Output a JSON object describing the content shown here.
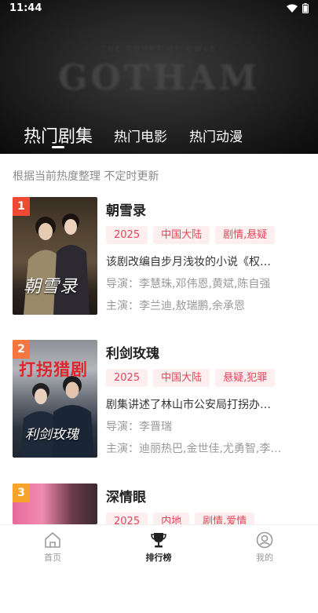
{
  "status": {
    "time": "11:44"
  },
  "banner": {
    "text": "GOTHAM"
  },
  "tabs": [
    {
      "label": "热门剧集",
      "active": true
    },
    {
      "label": "热门电影",
      "active": false
    },
    {
      "label": "热门动漫",
      "active": false
    }
  ],
  "subtitle": "根据当前热度整理 不定时更新",
  "items": [
    {
      "rank": "1",
      "title": "朝雪录",
      "tags": [
        "2025",
        "中国大陆",
        "剧情,悬疑"
      ],
      "desc": "该剧改编自步月浅妆的小说《权…",
      "director": "导演：李慧珠,邓伟恩,黄斌,陈自强",
      "cast": "主演：李兰迪,敖瑞鹏,余承恩",
      "poster_text": "朝雪录"
    },
    {
      "rank": "2",
      "title": "利剑玫瑰",
      "tags": [
        "2025",
        "中国大陆",
        "悬疑,犯罪"
      ],
      "desc": "剧集讲述了林山市公安局打拐办…",
      "director": "导演：李晋瑞",
      "cast": "主演：迪丽热巴,金世佳,尤勇智,李…",
      "poster_text_top": "打拐猎剧",
      "poster_text": "利剑玫瑰"
    },
    {
      "rank": "3",
      "title": "深情眼",
      "tags": [
        "2025",
        "内地",
        "剧情,爱情"
      ]
    }
  ],
  "nav": [
    {
      "label": "首页",
      "active": false,
      "icon": "home-icon"
    },
    {
      "label": "排行榜",
      "active": true,
      "icon": "trophy-icon"
    },
    {
      "label": "我的",
      "active": false,
      "icon": "profile-icon"
    }
  ]
}
